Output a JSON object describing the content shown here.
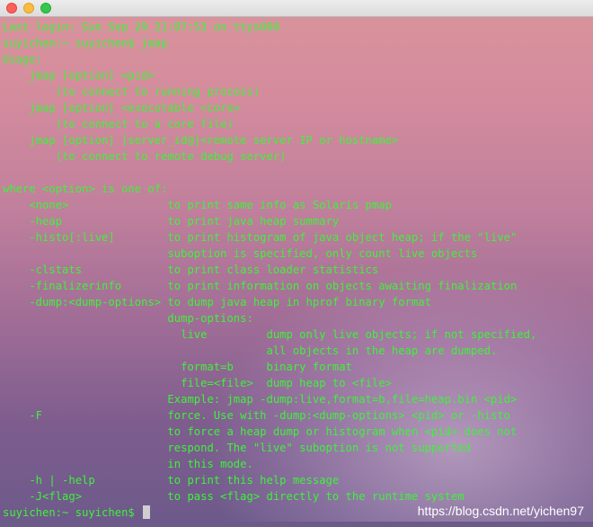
{
  "window": {
    "traffic_lights": [
      "close",
      "minimize",
      "zoom"
    ]
  },
  "terminal": {
    "lines": [
      "Last login: Sun Sep 29 21:07:53 on ttys000",
      "suyichen:~ suyichen$ jmap",
      "Usage:",
      "    jmap [option] <pid>",
      "        (to connect to running process)",
      "    jmap [option] <executable <core>",
      "        (to connect to a core file)",
      "    jmap [option] [server_id@]<remote server IP or hostname>",
      "        (to connect to remote debug server)",
      "",
      "where <option> is one of:",
      "    <none>               to print same info as Solaris pmap",
      "    -heap                to print java heap summary",
      "    -histo[:live]        to print histogram of java object heap; if the \"live\"",
      "                         suboption is specified, only count live objects",
      "    -clstats             to print class loader statistics",
      "    -finalizerinfo       to print information on objects awaiting finalization",
      "    -dump:<dump-options> to dump java heap in hprof binary format",
      "                         dump-options:",
      "                           live         dump only live objects; if not specified,",
      "                                        all objects in the heap are dumped.",
      "                           format=b     binary format",
      "                           file=<file>  dump heap to <file>",
      "                         Example: jmap -dump:live,format=b,file=heap.bin <pid>",
      "    -F                   force. Use with -dump:<dump-options> <pid> or -histo",
      "                         to force a heap dump or histogram when <pid> does not",
      "                         respond. The \"live\" suboption is not supported",
      "                         in this mode.",
      "    -h | -help           to print this help message",
      "    -J<flag>             to pass <flag> directly to the runtime system"
    ],
    "prompt": "suyichen:~ suyichen$ "
  },
  "watermark": "https://blog.csdn.net/yichen97",
  "colors": {
    "text": "#3ff23a",
    "cursor": "#cfcfcf",
    "titlebar": "#e3e3e3"
  }
}
